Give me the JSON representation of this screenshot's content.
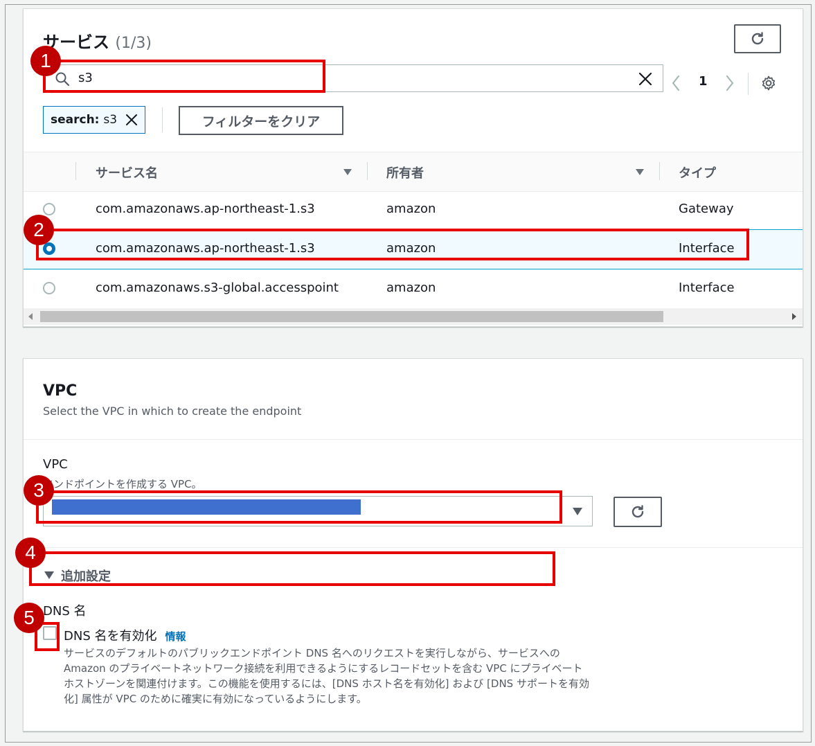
{
  "services": {
    "title": "サービス",
    "count": "(1/3)",
    "search": {
      "value": "s3"
    },
    "pagination": {
      "page": "1"
    },
    "filter_chip": {
      "key": "search:",
      "value": "s3"
    },
    "clear_filters_label": "フィルターをクリア",
    "columns": [
      "サービス名",
      "所有者",
      "タイプ"
    ],
    "rows": [
      {
        "name": "com.amazonaws.ap-northeast-1.s3",
        "owner": "amazon",
        "type": "Gateway",
        "selected": false
      },
      {
        "name": "com.amazonaws.ap-northeast-1.s3",
        "owner": "amazon",
        "type": "Interface",
        "selected": true
      },
      {
        "name": "com.amazonaws.s3-global.accesspoint",
        "owner": "amazon",
        "type": "Interface",
        "selected": false
      }
    ]
  },
  "vpc": {
    "title": "VPC",
    "description": "Select the VPC in which to create the endpoint",
    "field_label": "VPC",
    "field_desc": "エンドポイントを作成する VPC。",
    "additional_settings": "追加設定",
    "dns_section_label": "DNS 名",
    "dns_checkbox_label": "DNS 名を有効化",
    "info_link": "情報",
    "dns_desc": "サービスのデフォルトのパブリックエンドポイント DNS 名へのリクエストを実行しながら、サービスへの Amazon のプライベートネットワーク接続を利用できるようにするレコードセットを含む VPC にプライベートホストゾーンを関連付けます。この機能を使用するには、[DNS ホスト名を有効化] および [DNS サポートを有効化] 属性が VPC のために確実に有効になっているようにします。"
  },
  "annotations": [
    "1",
    "2",
    "3",
    "4",
    "5"
  ],
  "colors": {
    "accent": "#0073bb",
    "annotation": "#e80000",
    "badge": "#c00000",
    "redacted": "#3f6fcf"
  }
}
